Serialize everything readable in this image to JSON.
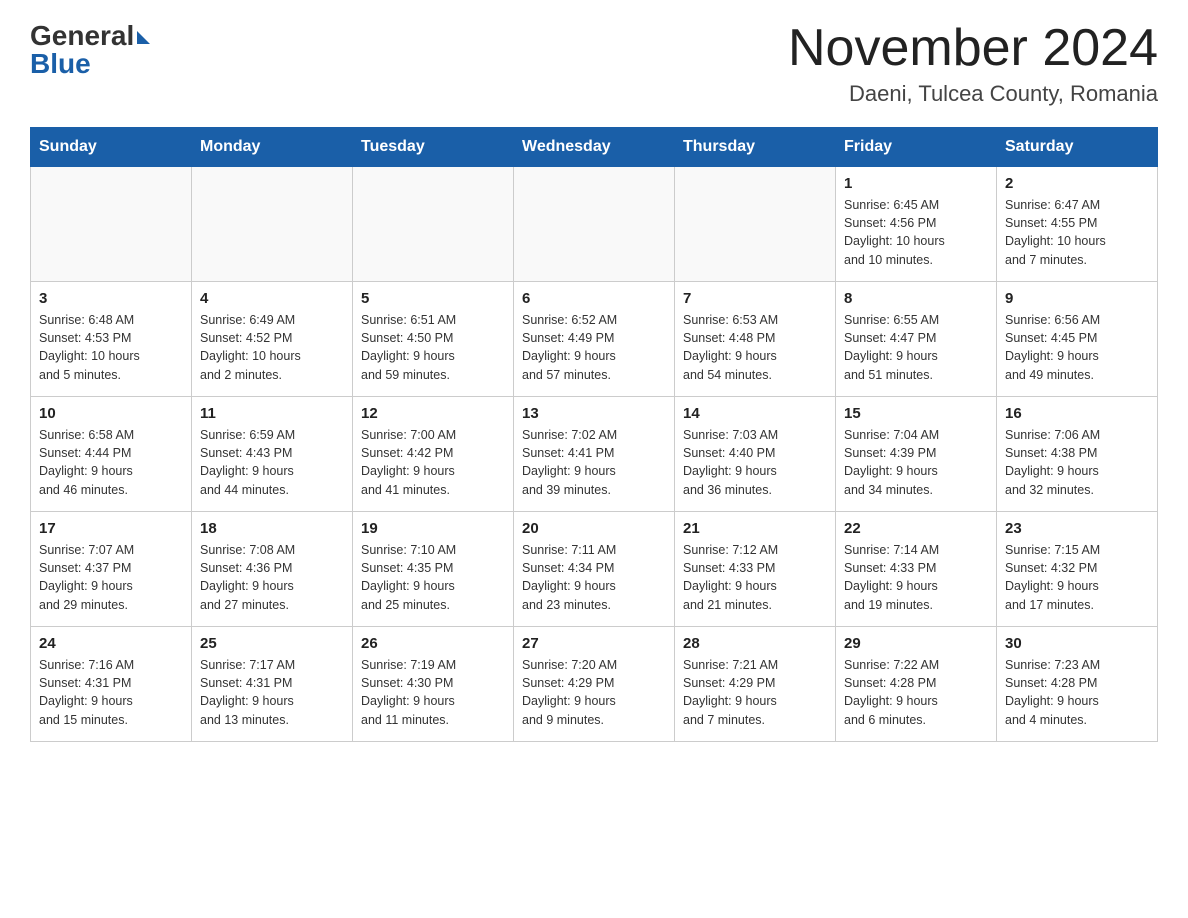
{
  "header": {
    "logo_general": "General",
    "logo_blue": "Blue",
    "month_title": "November 2024",
    "location": "Daeni, Tulcea County, Romania"
  },
  "weekdays": [
    "Sunday",
    "Monday",
    "Tuesday",
    "Wednesday",
    "Thursday",
    "Friday",
    "Saturday"
  ],
  "weeks": [
    [
      {
        "day": "",
        "info": ""
      },
      {
        "day": "",
        "info": ""
      },
      {
        "day": "",
        "info": ""
      },
      {
        "day": "",
        "info": ""
      },
      {
        "day": "",
        "info": ""
      },
      {
        "day": "1",
        "info": "Sunrise: 6:45 AM\nSunset: 4:56 PM\nDaylight: 10 hours\nand 10 minutes."
      },
      {
        "day": "2",
        "info": "Sunrise: 6:47 AM\nSunset: 4:55 PM\nDaylight: 10 hours\nand 7 minutes."
      }
    ],
    [
      {
        "day": "3",
        "info": "Sunrise: 6:48 AM\nSunset: 4:53 PM\nDaylight: 10 hours\nand 5 minutes."
      },
      {
        "day": "4",
        "info": "Sunrise: 6:49 AM\nSunset: 4:52 PM\nDaylight: 10 hours\nand 2 minutes."
      },
      {
        "day": "5",
        "info": "Sunrise: 6:51 AM\nSunset: 4:50 PM\nDaylight: 9 hours\nand 59 minutes."
      },
      {
        "day": "6",
        "info": "Sunrise: 6:52 AM\nSunset: 4:49 PM\nDaylight: 9 hours\nand 57 minutes."
      },
      {
        "day": "7",
        "info": "Sunrise: 6:53 AM\nSunset: 4:48 PM\nDaylight: 9 hours\nand 54 minutes."
      },
      {
        "day": "8",
        "info": "Sunrise: 6:55 AM\nSunset: 4:47 PM\nDaylight: 9 hours\nand 51 minutes."
      },
      {
        "day": "9",
        "info": "Sunrise: 6:56 AM\nSunset: 4:45 PM\nDaylight: 9 hours\nand 49 minutes."
      }
    ],
    [
      {
        "day": "10",
        "info": "Sunrise: 6:58 AM\nSunset: 4:44 PM\nDaylight: 9 hours\nand 46 minutes."
      },
      {
        "day": "11",
        "info": "Sunrise: 6:59 AM\nSunset: 4:43 PM\nDaylight: 9 hours\nand 44 minutes."
      },
      {
        "day": "12",
        "info": "Sunrise: 7:00 AM\nSunset: 4:42 PM\nDaylight: 9 hours\nand 41 minutes."
      },
      {
        "day": "13",
        "info": "Sunrise: 7:02 AM\nSunset: 4:41 PM\nDaylight: 9 hours\nand 39 minutes."
      },
      {
        "day": "14",
        "info": "Sunrise: 7:03 AM\nSunset: 4:40 PM\nDaylight: 9 hours\nand 36 minutes."
      },
      {
        "day": "15",
        "info": "Sunrise: 7:04 AM\nSunset: 4:39 PM\nDaylight: 9 hours\nand 34 minutes."
      },
      {
        "day": "16",
        "info": "Sunrise: 7:06 AM\nSunset: 4:38 PM\nDaylight: 9 hours\nand 32 minutes."
      }
    ],
    [
      {
        "day": "17",
        "info": "Sunrise: 7:07 AM\nSunset: 4:37 PM\nDaylight: 9 hours\nand 29 minutes."
      },
      {
        "day": "18",
        "info": "Sunrise: 7:08 AM\nSunset: 4:36 PM\nDaylight: 9 hours\nand 27 minutes."
      },
      {
        "day": "19",
        "info": "Sunrise: 7:10 AM\nSunset: 4:35 PM\nDaylight: 9 hours\nand 25 minutes."
      },
      {
        "day": "20",
        "info": "Sunrise: 7:11 AM\nSunset: 4:34 PM\nDaylight: 9 hours\nand 23 minutes."
      },
      {
        "day": "21",
        "info": "Sunrise: 7:12 AM\nSunset: 4:33 PM\nDaylight: 9 hours\nand 21 minutes."
      },
      {
        "day": "22",
        "info": "Sunrise: 7:14 AM\nSunset: 4:33 PM\nDaylight: 9 hours\nand 19 minutes."
      },
      {
        "day": "23",
        "info": "Sunrise: 7:15 AM\nSunset: 4:32 PM\nDaylight: 9 hours\nand 17 minutes."
      }
    ],
    [
      {
        "day": "24",
        "info": "Sunrise: 7:16 AM\nSunset: 4:31 PM\nDaylight: 9 hours\nand 15 minutes."
      },
      {
        "day": "25",
        "info": "Sunrise: 7:17 AM\nSunset: 4:31 PM\nDaylight: 9 hours\nand 13 minutes."
      },
      {
        "day": "26",
        "info": "Sunrise: 7:19 AM\nSunset: 4:30 PM\nDaylight: 9 hours\nand 11 minutes."
      },
      {
        "day": "27",
        "info": "Sunrise: 7:20 AM\nSunset: 4:29 PM\nDaylight: 9 hours\nand 9 minutes."
      },
      {
        "day": "28",
        "info": "Sunrise: 7:21 AM\nSunset: 4:29 PM\nDaylight: 9 hours\nand 7 minutes."
      },
      {
        "day": "29",
        "info": "Sunrise: 7:22 AM\nSunset: 4:28 PM\nDaylight: 9 hours\nand 6 minutes."
      },
      {
        "day": "30",
        "info": "Sunrise: 7:23 AM\nSunset: 4:28 PM\nDaylight: 9 hours\nand 4 minutes."
      }
    ]
  ]
}
